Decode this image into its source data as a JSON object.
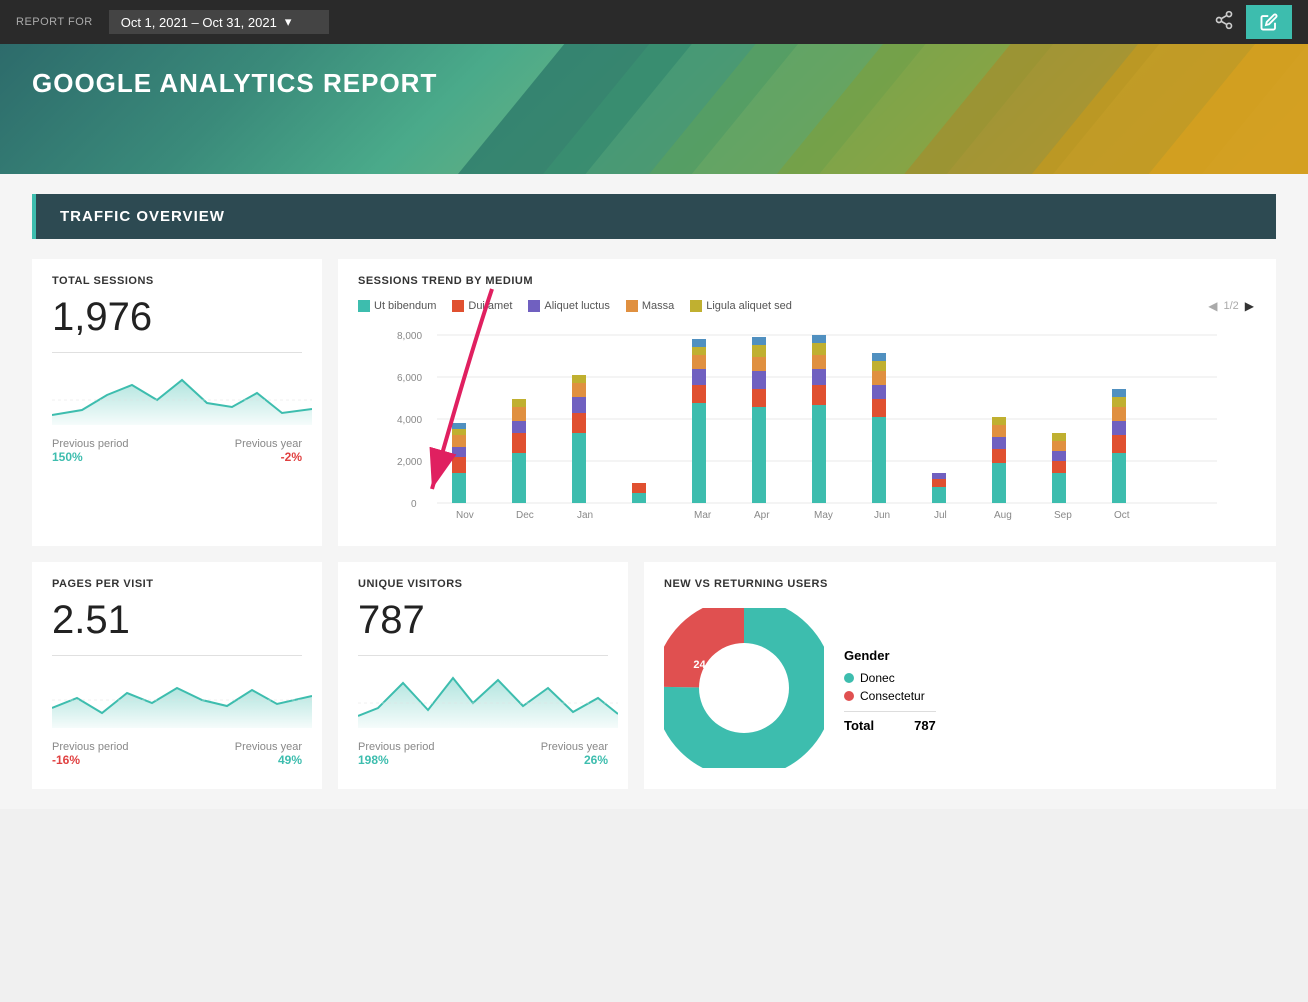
{
  "header": {
    "report_for_label": "REPORT FOR",
    "date_range": "Oct 1, 2021 – Oct 31, 2021",
    "share_icon": "⬡",
    "edit_icon": "✎"
  },
  "title": "GOOGLE ANALYTICS REPORT",
  "sections": {
    "traffic_overview": {
      "label": "TRAFFIC OVERVIEW",
      "total_sessions": {
        "label": "TOTAL SESSIONS",
        "value": "1,976",
        "previous_period_label": "Previous period",
        "previous_period_value": "150%",
        "previous_period_positive": true,
        "previous_year_label": "Previous year",
        "previous_year_value": "-2%",
        "previous_year_positive": false
      },
      "pages_per_visit": {
        "label": "PAGES PER VISIT",
        "value": "2.51",
        "previous_period_label": "Previous period",
        "previous_period_value": "-16%",
        "previous_period_positive": false,
        "previous_year_label": "Previous year",
        "previous_year_value": "49%",
        "previous_year_positive": true
      },
      "unique_visitors": {
        "label": "UNIQUE VISITORS",
        "value": "787",
        "previous_period_label": "Previous period",
        "previous_period_value": "198%",
        "previous_period_positive": true,
        "previous_year_label": "Previous year",
        "previous_year_value": "26%",
        "previous_year_positive": true
      },
      "sessions_trend": {
        "title": "SESSIONS TREND BY MEDIUM",
        "pagination": "1/2",
        "legend": [
          {
            "label": "Ut bibendum",
            "color": "#3dbdae"
          },
          {
            "label": "Dui amet",
            "color": "#e05030"
          },
          {
            "label": "Aliquet luctus",
            "color": "#7060c0"
          },
          {
            "label": "Massa",
            "color": "#e09040"
          },
          {
            "label": "Ligula aliquet sed",
            "color": "#c0b030"
          }
        ],
        "months": [
          "Nov",
          "Dec",
          "Jan",
          "",
          "Mar",
          "Apr",
          "May",
          "Jun",
          "Jul",
          "Aug",
          "Sep",
          "Oct"
        ],
        "y_labels": [
          "8,000",
          "6,000",
          "4,000",
          "2,000",
          "0"
        ]
      },
      "new_vs_returning": {
        "title": "NEW VS RETURNING USERS",
        "gender_title": "Gender",
        "segments": [
          {
            "label": "Donec",
            "color": "#3dbdae",
            "percentage": 75.2
          },
          {
            "label": "Consectetur",
            "color": "#e05050",
            "percentage": 24.8
          }
        ],
        "total_label": "Total",
        "total_value": "787"
      }
    }
  }
}
